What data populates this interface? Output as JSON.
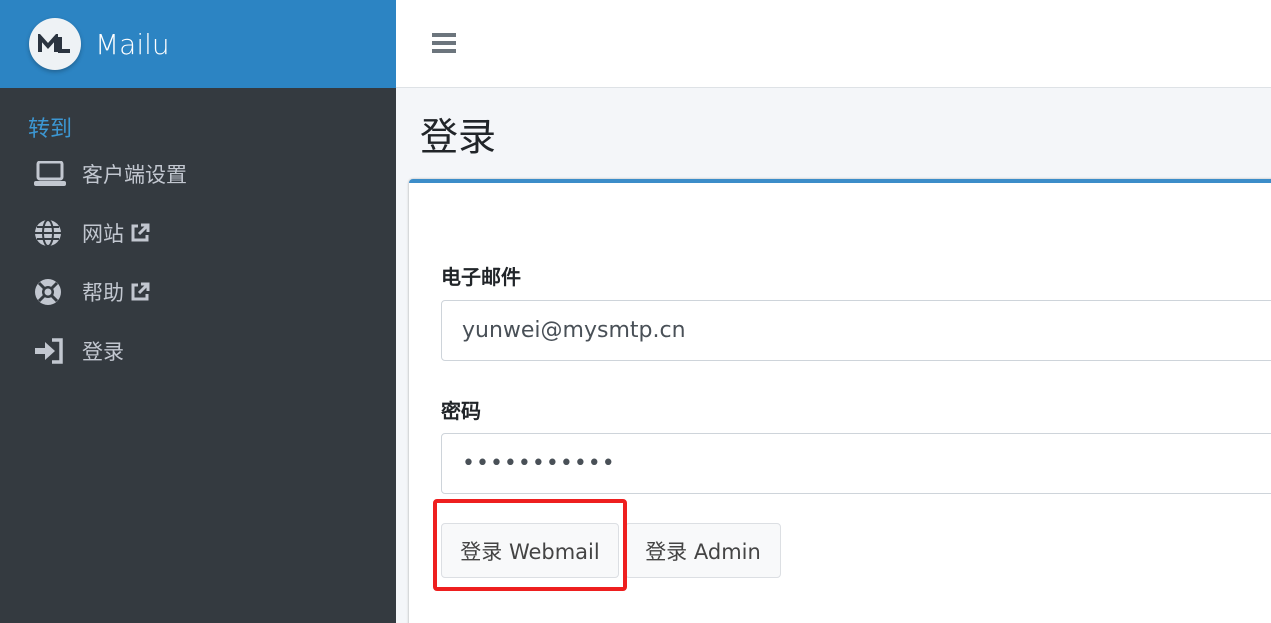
{
  "brand": {
    "name": "Mailu",
    "logo_icon": "mailu-logo-icon"
  },
  "sidebar": {
    "section_header": "转到",
    "items": [
      {
        "label": "客户端设置",
        "icon": "laptop-icon",
        "external": false
      },
      {
        "label": "网站",
        "icon": "globe-icon",
        "external": true
      },
      {
        "label": "帮助",
        "icon": "lifebuoy-icon",
        "external": true
      },
      {
        "label": "登录",
        "icon": "sign-in-icon",
        "external": false
      }
    ]
  },
  "topbar": {
    "menu_icon": "hamburger-icon"
  },
  "page": {
    "title": "登录"
  },
  "form": {
    "email_label": "电子邮件",
    "email_value": "yunwei@mysmtp.cn",
    "password_label": "密码",
    "password_value": "•••••••••••",
    "webmail_button": "登录 Webmail",
    "admin_button": "登录 Admin"
  },
  "colors": {
    "brand_bar": "#2c84c3",
    "sidebar_bg": "#343a40",
    "section_header": "#3c97d3",
    "card_accent": "#3c8dc9",
    "highlight": "#ee1f1f"
  }
}
